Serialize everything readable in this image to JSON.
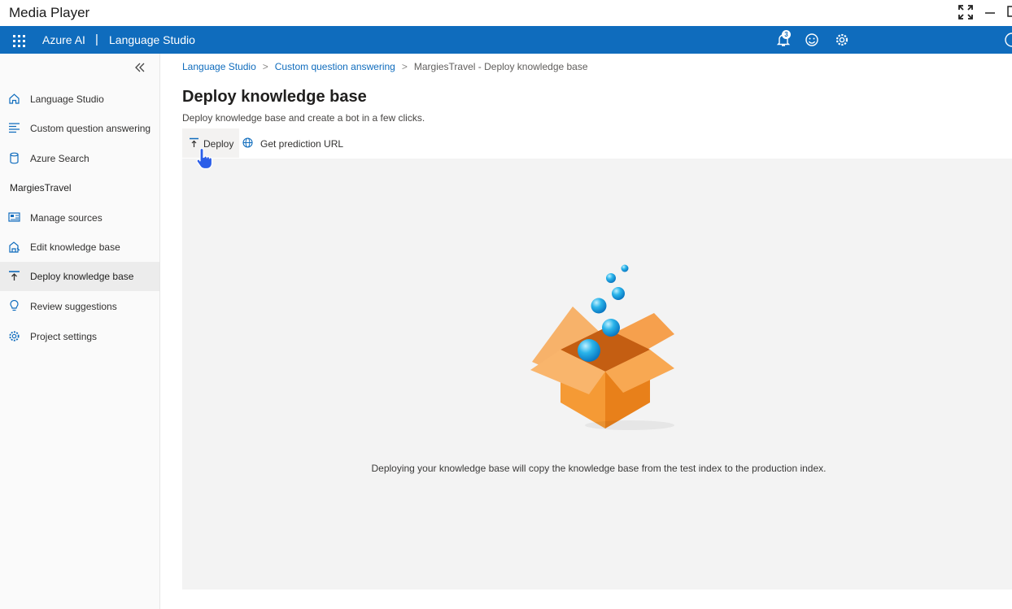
{
  "window": {
    "title": "Media Player"
  },
  "header": {
    "brand": "Azure AI",
    "separator": "|",
    "product": "Language Studio",
    "notification_count": "3",
    "accent_color": "#0f6cbd"
  },
  "sidebar": {
    "top_items": [
      {
        "label": "Language Studio",
        "icon": "home-icon"
      },
      {
        "label": "Custom question answering",
        "icon": "list-icon"
      },
      {
        "label": "Azure Search",
        "icon": "database-icon"
      }
    ],
    "project_name": "MargiesTravel",
    "project_items": [
      {
        "label": "Manage sources",
        "icon": "sources-icon"
      },
      {
        "label": "Edit knowledge base",
        "icon": "knowledge-base-icon"
      },
      {
        "label": "Deploy knowledge base",
        "icon": "deploy-icon",
        "active": true
      },
      {
        "label": "Review suggestions",
        "icon": "lightbulb-icon"
      },
      {
        "label": "Project settings",
        "icon": "gear-icon"
      }
    ]
  },
  "breadcrumb": {
    "items": [
      "Language Studio",
      "Custom question answering"
    ],
    "current": "MargiesTravel - Deploy knowledge base"
  },
  "page": {
    "title": "Deploy knowledge base",
    "subtitle": "Deploy knowledge base and create a bot in a few clicks."
  },
  "commands": {
    "deploy": "Deploy",
    "prediction_url": "Get prediction URL"
  },
  "panel": {
    "message": "Deploying your knowledge base will copy the knowledge base from the test index to the production index."
  }
}
